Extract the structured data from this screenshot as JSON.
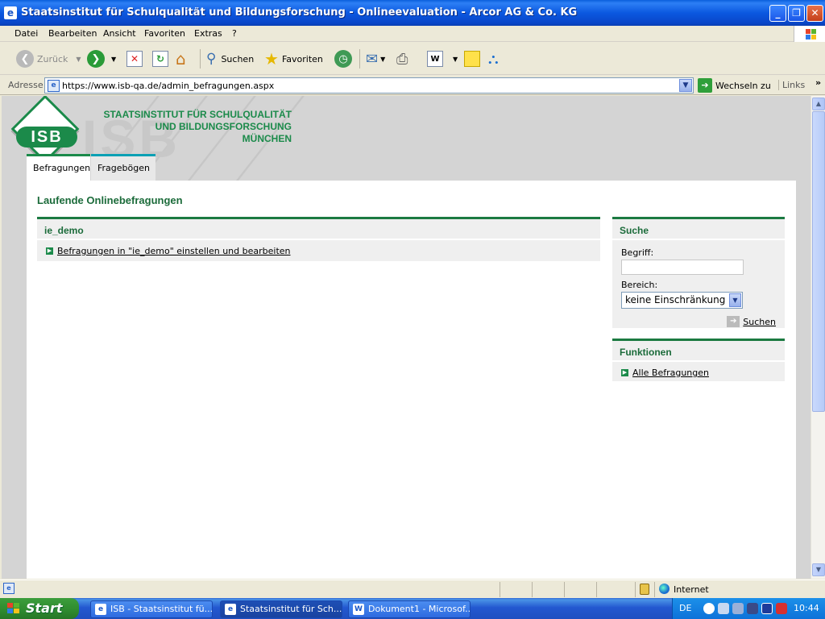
{
  "window": {
    "title": "Staatsinstitut für Schulqualität und Bildungsforschung - Onlineevaluation - Arcor AG & Co. KG"
  },
  "menu": [
    "Datei",
    "Bearbeiten",
    "Ansicht",
    "Favoriten",
    "Extras",
    "?"
  ],
  "toolbar": {
    "back_label": "Zurück",
    "search_label": "Suchen",
    "favorites_label": "Favoriten"
  },
  "address": {
    "label": "Adresse",
    "url": "https://www.isb-qa.de/admin_befragungen.aspx",
    "go_label": "Wechseln zu",
    "links_label": "Links"
  },
  "header": {
    "logo_text": "ISB",
    "watermark_text": "ISB",
    "institute_line1": "STAATSINSTITUT FÜR SCHULQUALITÄT",
    "institute_line2": "UND BILDUNGSFORSCHUNG",
    "institute_line3": "MÜNCHEN"
  },
  "tabs": [
    {
      "label": "Befragungen",
      "active": true
    },
    {
      "label": "Fragebögen",
      "active": false
    }
  ],
  "main": {
    "title": "Laufende Onlinebefragungen",
    "panel_title": "ie_demo",
    "panel_link": "Befragungen in \"ie_demo\" einstellen und bearbeiten"
  },
  "search_panel": {
    "title": "Suche",
    "term_label": "Begriff:",
    "term_value": "",
    "area_label": "Bereich:",
    "area_selected": "keine Einschränkung",
    "search_button": "Suchen"
  },
  "functions_panel": {
    "title": "Funktionen",
    "link": "Alle Befragungen"
  },
  "statusbar": {
    "zone": "Internet"
  },
  "taskbar": {
    "start_label": "Start",
    "tasks": [
      {
        "label": "ISB - Staatsinstitut fü...",
        "active": false
      },
      {
        "label": "Staatsinstitut für Sch...",
        "active": true
      },
      {
        "label": "Dokument1 - Microsof...",
        "active": false
      }
    ],
    "language": "DE",
    "clock": "10:44"
  },
  "colors": {
    "brand_green": "#1b8a4a",
    "heading_green": "#1b6b3a",
    "tab_inactive_accent": "#0aa0b4",
    "xp_blue": "#0b58e0"
  }
}
